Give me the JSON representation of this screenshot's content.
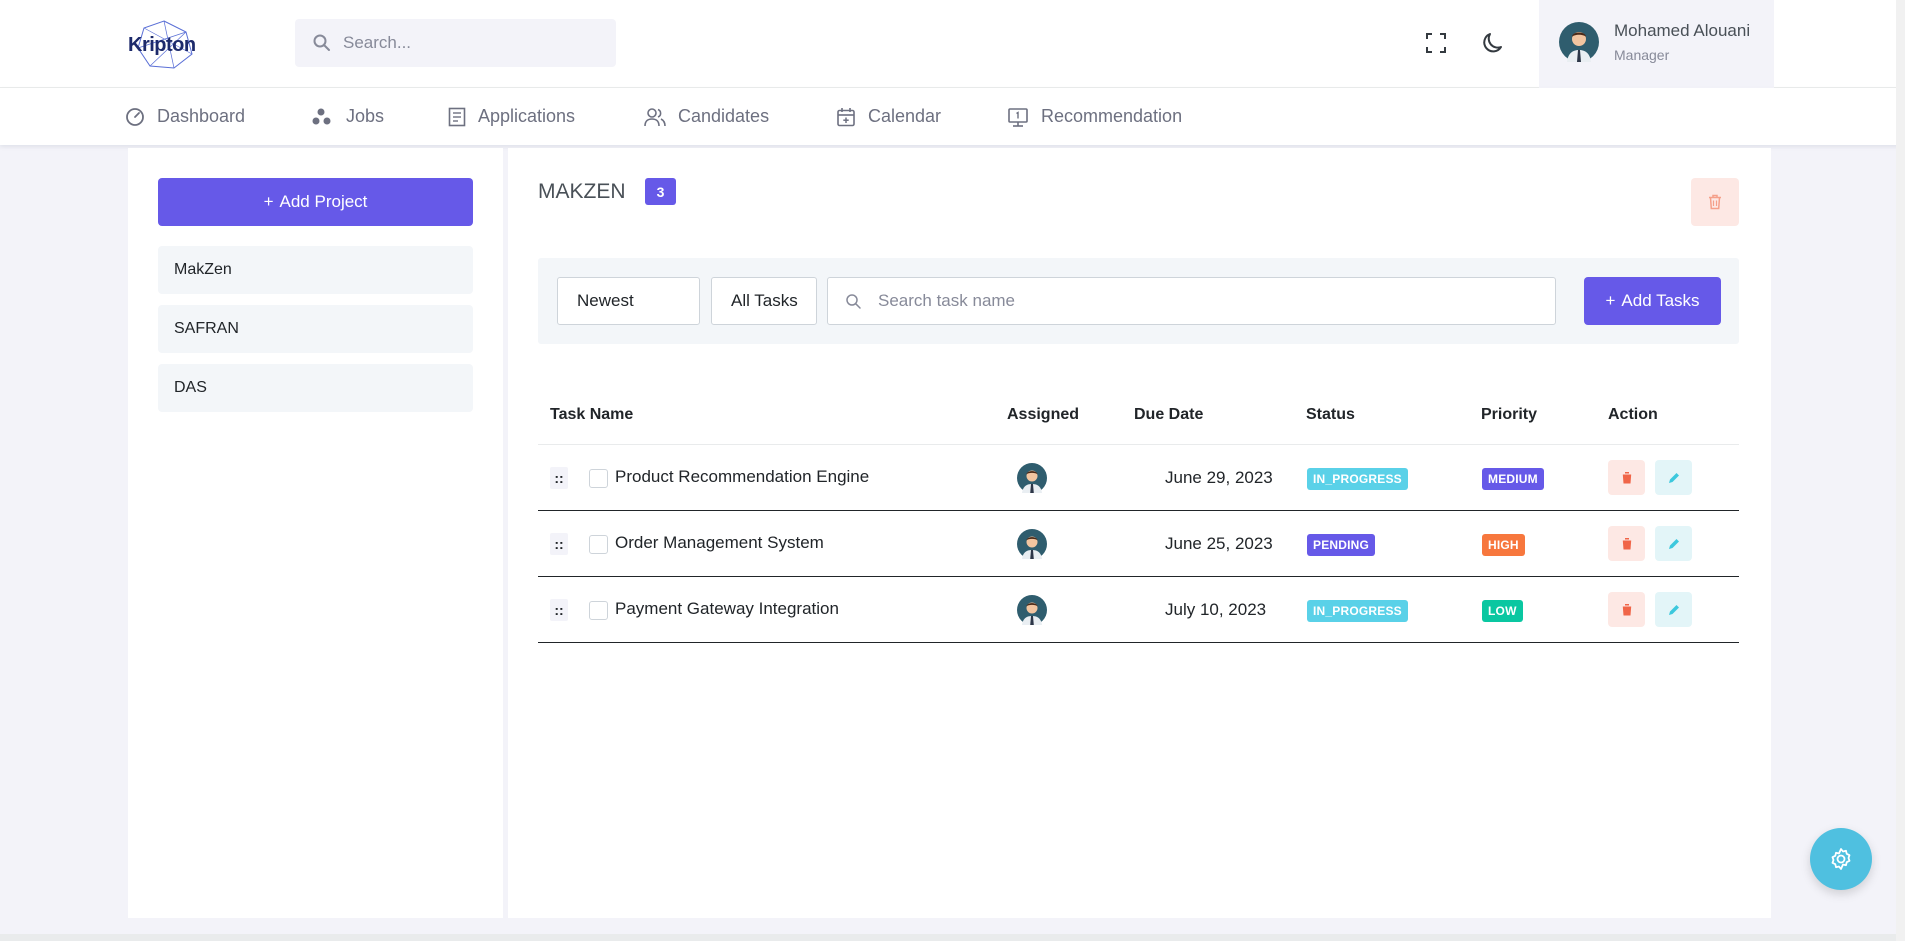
{
  "header": {
    "logo_text": "Kripton",
    "search_placeholder": "Search...",
    "user": {
      "name": "Mohamed Alouani",
      "role": "Manager"
    }
  },
  "nav": [
    {
      "label": "Dashboard",
      "icon": "dashboard-icon"
    },
    {
      "label": "Jobs",
      "icon": "jobs-icon"
    },
    {
      "label": "Applications",
      "icon": "applications-icon"
    },
    {
      "label": "Candidates",
      "icon": "candidates-icon"
    },
    {
      "label": "Calendar",
      "icon": "calendar-icon"
    },
    {
      "label": "Recommendation",
      "icon": "recommendation-icon"
    }
  ],
  "sidebar": {
    "add_project_label": "Add Project",
    "projects": [
      "MakZen",
      "SAFRAN",
      "DAS"
    ]
  },
  "project": {
    "title": "MAKZEN",
    "task_count": "3"
  },
  "filters": {
    "sort": "Newest",
    "scope": "All Tasks",
    "search_placeholder": "Search task name",
    "add_tasks_label": "Add Tasks"
  },
  "table": {
    "columns": [
      "Task Name",
      "Assigned",
      "Due Date",
      "Status",
      "Priority",
      "Action"
    ],
    "rows": [
      {
        "drag": "::",
        "name": "Product Recommendation Engine",
        "due": "June 29, 2023",
        "status": "IN_PROGRESS",
        "priority": "MEDIUM"
      },
      {
        "drag": "::",
        "name": "Order Management System",
        "due": "June 25, 2023",
        "status": "PENDING",
        "priority": "HIGH"
      },
      {
        "drag": "::",
        "name": "Payment Gateway Integration",
        "due": "July 10, 2023",
        "status": "IN_PROGRESS",
        "priority": "LOW"
      }
    ]
  },
  "colors": {
    "primary": "#6659e8",
    "in_progress": "#5ad1e8",
    "pending": "#6659e8",
    "medium": "#6659e8",
    "high": "#f7773d",
    "low": "#0ac7a1",
    "danger": "#f06548",
    "info": "#3cc8dd",
    "fab": "#4fc0e0"
  }
}
